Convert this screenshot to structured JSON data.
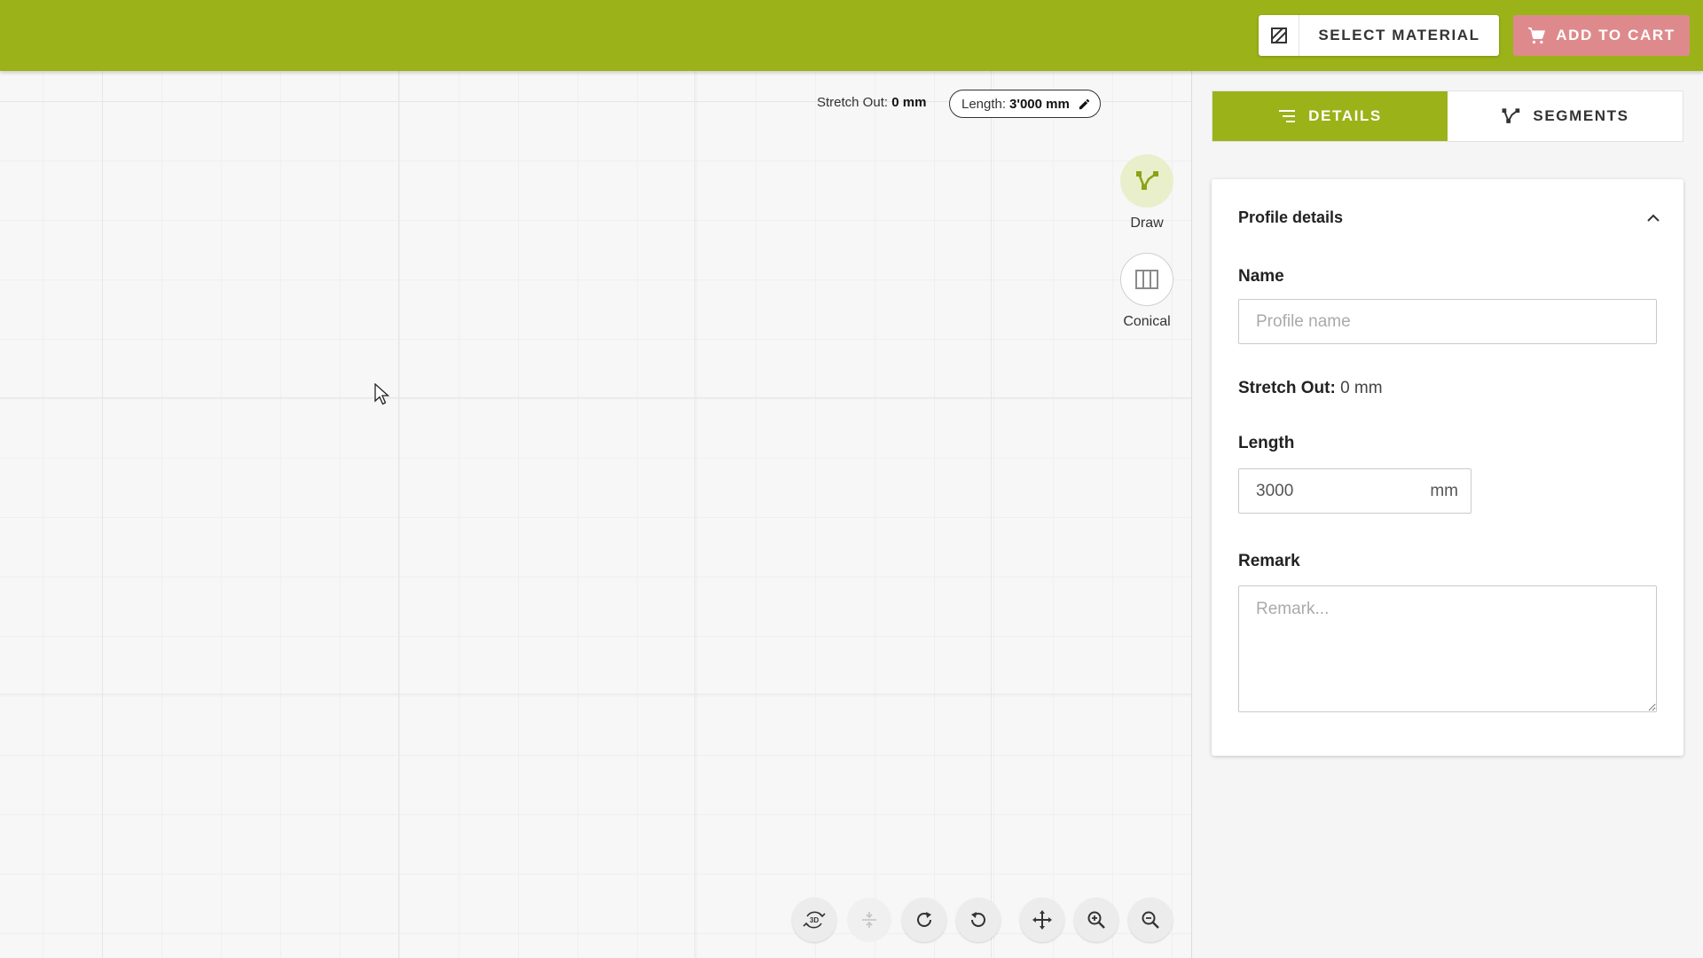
{
  "header": {
    "select_material_label": "SELECT MATERIAL",
    "add_to_cart_label": "ADD TO CART",
    "brand_color": "#9bb218",
    "cart_color": "#de8a8c"
  },
  "canvas": {
    "stretch_out_label": "Stretch Out:",
    "stretch_out_value": "0 mm",
    "length_label": "Length:",
    "length_value": "3'000 mm",
    "tools": [
      {
        "label": "Draw",
        "icon": "draw-polyline-icon"
      },
      {
        "label": "Conical",
        "icon": "conical-columns-icon"
      }
    ],
    "bottom_toolbar": [
      {
        "icon": "rotate-3d-icon"
      },
      {
        "icon": "flip-vertical-icon",
        "disabled": true
      },
      {
        "icon": "rotate-clockwise-icon"
      },
      {
        "icon": "rotate-counterclockwise-icon"
      },
      {
        "icon": "pan-move-icon"
      },
      {
        "icon": "zoom-in-icon"
      },
      {
        "icon": "zoom-out-icon"
      }
    ]
  },
  "panel": {
    "tabs": [
      {
        "label": "DETAILS",
        "icon": "list-lines-icon",
        "active": true
      },
      {
        "label": "SEGMENTS",
        "icon": "segments-icon",
        "active": false
      }
    ],
    "card": {
      "title": "Profile details",
      "name_label": "Name",
      "name_value": "",
      "name_placeholder": "Profile name",
      "stretch_out_label": "Stretch Out:",
      "stretch_out_value": "0 mm",
      "length_label": "Length",
      "length_value": "3000",
      "length_unit": "mm",
      "remark_label": "Remark",
      "remark_value": "",
      "remark_placeholder": "Remark..."
    }
  }
}
